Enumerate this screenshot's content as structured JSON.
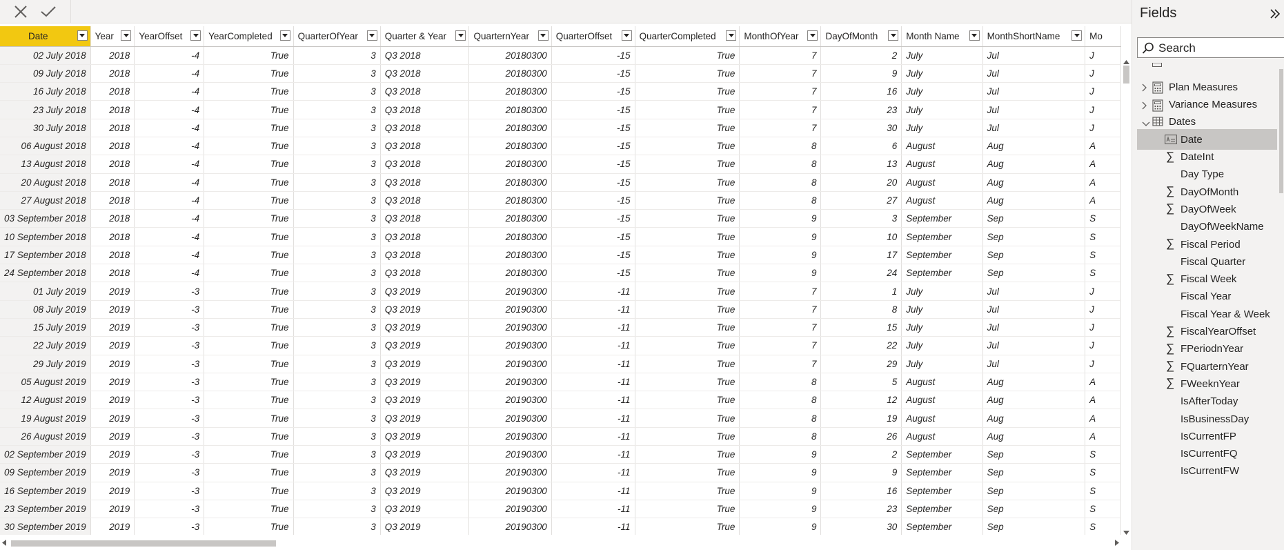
{
  "toolbar": {
    "cancel_icon": "close-icon",
    "commit_icon": "check-icon"
  },
  "grid": {
    "columns": [
      "Date",
      "Year",
      "YearOffset",
      "YearCompleted",
      "QuarterOfYear",
      "Quarter & Year",
      "QuarternYear",
      "QuarterOffset",
      "QuarterCompleted",
      "MonthOfYear",
      "DayOfMonth",
      "Month Name",
      "MonthShortName",
      "Mo"
    ],
    "rows": [
      [
        "02 July 2018",
        "2018",
        "-4",
        "True",
        "3",
        "Q3 2018",
        "20180300",
        "-15",
        "True",
        "7",
        "2",
        "July",
        "Jul",
        "J"
      ],
      [
        "09 July 2018",
        "2018",
        "-4",
        "True",
        "3",
        "Q3 2018",
        "20180300",
        "-15",
        "True",
        "7",
        "9",
        "July",
        "Jul",
        "J"
      ],
      [
        "16 July 2018",
        "2018",
        "-4",
        "True",
        "3",
        "Q3 2018",
        "20180300",
        "-15",
        "True",
        "7",
        "16",
        "July",
        "Jul",
        "J"
      ],
      [
        "23 July 2018",
        "2018",
        "-4",
        "True",
        "3",
        "Q3 2018",
        "20180300",
        "-15",
        "True",
        "7",
        "23",
        "July",
        "Jul",
        "J"
      ],
      [
        "30 July 2018",
        "2018",
        "-4",
        "True",
        "3",
        "Q3 2018",
        "20180300",
        "-15",
        "True",
        "7",
        "30",
        "July",
        "Jul",
        "J"
      ],
      [
        "06 August 2018",
        "2018",
        "-4",
        "True",
        "3",
        "Q3 2018",
        "20180300",
        "-15",
        "True",
        "8",
        "6",
        "August",
        "Aug",
        "A"
      ],
      [
        "13 August 2018",
        "2018",
        "-4",
        "True",
        "3",
        "Q3 2018",
        "20180300",
        "-15",
        "True",
        "8",
        "13",
        "August",
        "Aug",
        "A"
      ],
      [
        "20 August 2018",
        "2018",
        "-4",
        "True",
        "3",
        "Q3 2018",
        "20180300",
        "-15",
        "True",
        "8",
        "20",
        "August",
        "Aug",
        "A"
      ],
      [
        "27 August 2018",
        "2018",
        "-4",
        "True",
        "3",
        "Q3 2018",
        "20180300",
        "-15",
        "True",
        "8",
        "27",
        "August",
        "Aug",
        "A"
      ],
      [
        "03 September 2018",
        "2018",
        "-4",
        "True",
        "3",
        "Q3 2018",
        "20180300",
        "-15",
        "True",
        "9",
        "3",
        "September",
        "Sep",
        "S"
      ],
      [
        "10 September 2018",
        "2018",
        "-4",
        "True",
        "3",
        "Q3 2018",
        "20180300",
        "-15",
        "True",
        "9",
        "10",
        "September",
        "Sep",
        "S"
      ],
      [
        "17 September 2018",
        "2018",
        "-4",
        "True",
        "3",
        "Q3 2018",
        "20180300",
        "-15",
        "True",
        "9",
        "17",
        "September",
        "Sep",
        "S"
      ],
      [
        "24 September 2018",
        "2018",
        "-4",
        "True",
        "3",
        "Q3 2018",
        "20180300",
        "-15",
        "True",
        "9",
        "24",
        "September",
        "Sep",
        "S"
      ],
      [
        "01 July 2019",
        "2019",
        "-3",
        "True",
        "3",
        "Q3 2019",
        "20190300",
        "-11",
        "True",
        "7",
        "1",
        "July",
        "Jul",
        "J"
      ],
      [
        "08 July 2019",
        "2019",
        "-3",
        "True",
        "3",
        "Q3 2019",
        "20190300",
        "-11",
        "True",
        "7",
        "8",
        "July",
        "Jul",
        "J"
      ],
      [
        "15 July 2019",
        "2019",
        "-3",
        "True",
        "3",
        "Q3 2019",
        "20190300",
        "-11",
        "True",
        "7",
        "15",
        "July",
        "Jul",
        "J"
      ],
      [
        "22 July 2019",
        "2019",
        "-3",
        "True",
        "3",
        "Q3 2019",
        "20190300",
        "-11",
        "True",
        "7",
        "22",
        "July",
        "Jul",
        "J"
      ],
      [
        "29 July 2019",
        "2019",
        "-3",
        "True",
        "3",
        "Q3 2019",
        "20190300",
        "-11",
        "True",
        "7",
        "29",
        "July",
        "Jul",
        "J"
      ],
      [
        "05 August 2019",
        "2019",
        "-3",
        "True",
        "3",
        "Q3 2019",
        "20190300",
        "-11",
        "True",
        "8",
        "5",
        "August",
        "Aug",
        "A"
      ],
      [
        "12 August 2019",
        "2019",
        "-3",
        "True",
        "3",
        "Q3 2019",
        "20190300",
        "-11",
        "True",
        "8",
        "12",
        "August",
        "Aug",
        "A"
      ],
      [
        "19 August 2019",
        "2019",
        "-3",
        "True",
        "3",
        "Q3 2019",
        "20190300",
        "-11",
        "True",
        "8",
        "19",
        "August",
        "Aug",
        "A"
      ],
      [
        "26 August 2019",
        "2019",
        "-3",
        "True",
        "3",
        "Q3 2019",
        "20190300",
        "-11",
        "True",
        "8",
        "26",
        "August",
        "Aug",
        "A"
      ],
      [
        "02 September 2019",
        "2019",
        "-3",
        "True",
        "3",
        "Q3 2019",
        "20190300",
        "-11",
        "True",
        "9",
        "2",
        "September",
        "Sep",
        "S"
      ],
      [
        "09 September 2019",
        "2019",
        "-3",
        "True",
        "3",
        "Q3 2019",
        "20190300",
        "-11",
        "True",
        "9",
        "9",
        "September",
        "Sep",
        "S"
      ],
      [
        "16 September 2019",
        "2019",
        "-3",
        "True",
        "3",
        "Q3 2019",
        "20190300",
        "-11",
        "True",
        "9",
        "16",
        "September",
        "Sep",
        "S"
      ],
      [
        "23 September 2019",
        "2019",
        "-3",
        "True",
        "3",
        "Q3 2019",
        "20190300",
        "-11",
        "True",
        "9",
        "23",
        "September",
        "Sep",
        "S"
      ],
      [
        "30 September 2019",
        "2019",
        "-3",
        "True",
        "3",
        "Q3 2019",
        "20190300",
        "-11",
        "True",
        "9",
        "30",
        "September",
        "Sep",
        "S"
      ]
    ],
    "selected_column": "Date",
    "selected_color": "#f2c811"
  },
  "fields_pane": {
    "title": "Fields",
    "search_placeholder": "Search",
    "groups": [
      {
        "label": "Plan Measures",
        "icon": "calculator-icon",
        "expanded": false
      },
      {
        "label": "Variance Measures",
        "icon": "calculator-icon",
        "expanded": false
      },
      {
        "label": "Dates",
        "icon": "table-icon",
        "expanded": true
      }
    ],
    "fields": [
      {
        "label": "Date",
        "kind": "text",
        "selected": true
      },
      {
        "label": "DateInt",
        "kind": "sum"
      },
      {
        "label": "Day Type",
        "kind": "none"
      },
      {
        "label": "DayOfMonth",
        "kind": "sum"
      },
      {
        "label": "DayOfWeek",
        "kind": "sum"
      },
      {
        "label": "DayOfWeekName",
        "kind": "none"
      },
      {
        "label": "Fiscal Period",
        "kind": "sum"
      },
      {
        "label": "Fiscal Quarter",
        "kind": "none"
      },
      {
        "label": "Fiscal Week",
        "kind": "sum"
      },
      {
        "label": "Fiscal Year",
        "kind": "none"
      },
      {
        "label": "Fiscal Year & Week",
        "kind": "none"
      },
      {
        "label": "FiscalYearOffset",
        "kind": "sum"
      },
      {
        "label": "FPeriodnYear",
        "kind": "sum"
      },
      {
        "label": "FQuarternYear",
        "kind": "sum"
      },
      {
        "label": "FWeeknYear",
        "kind": "sum"
      },
      {
        "label": "IsAfterToday",
        "kind": "none"
      },
      {
        "label": "IsBusinessDay",
        "kind": "none"
      },
      {
        "label": "IsCurrentFP",
        "kind": "none"
      },
      {
        "label": "IsCurrentFQ",
        "kind": "none"
      },
      {
        "label": "IsCurrentFW",
        "kind": "none"
      }
    ]
  }
}
